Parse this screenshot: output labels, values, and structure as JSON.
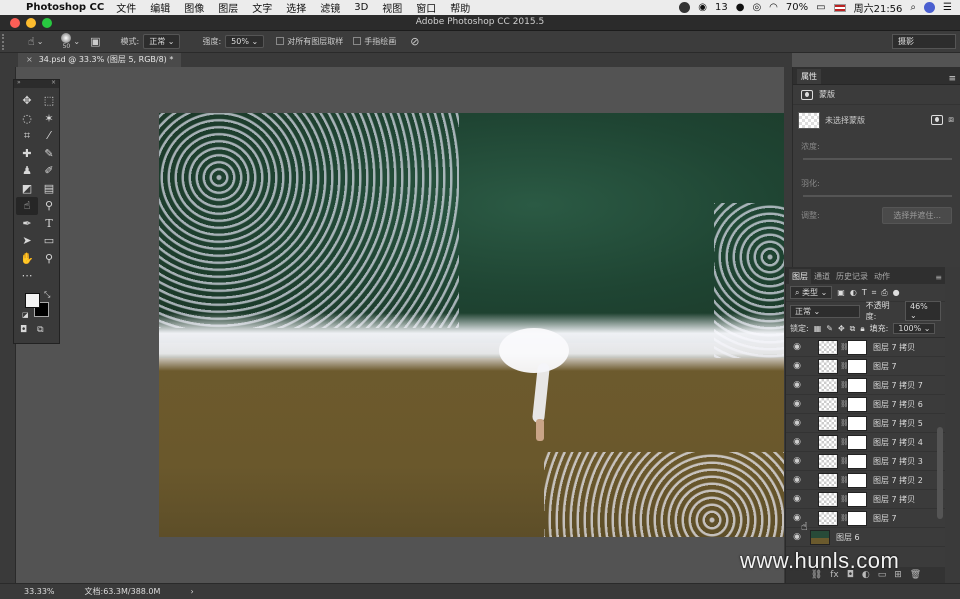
{
  "menubar": {
    "app_name": "Photoshop CC",
    "items": [
      "文件",
      "编辑",
      "图像",
      "图层",
      "文字",
      "选择",
      "滤镜",
      "3D",
      "视图",
      "窗口",
      "帮助"
    ],
    "wechat_count": "13",
    "battery": "70%",
    "clock": "周六21:56"
  },
  "titlebar": {
    "title": "Adobe Photoshop CC 2015.5"
  },
  "options": {
    "brush_size": "50",
    "mode_label": "模式:",
    "mode_value": "正常",
    "strength_label": "强度:",
    "strength_value": "50%",
    "sample_all_layers": "对所有图层取样",
    "finger_painting": "手指绘画",
    "workspace": "摄影"
  },
  "document": {
    "tab_label": "34.psd @ 33.3% (图层 5, RGB/8) *"
  },
  "properties": {
    "tab": "属性",
    "section": "蒙版",
    "no_mask": "未选择蒙版",
    "density_label": "浓度:",
    "feather_label": "羽化:",
    "adjust_label": "调整:",
    "select_mask_button": "选择并遮住..."
  },
  "layers_panel": {
    "tabs": [
      "图层",
      "通道",
      "历史记录",
      "动作"
    ],
    "filter_kind": "类型",
    "blend_mode": "正常",
    "opacity_label": "不透明度:",
    "opacity_value": "46%",
    "lock_label": "锁定:",
    "fill_label": "填充:",
    "fill_value": "100%",
    "layers": [
      {
        "name": "图层 7 拷贝"
      },
      {
        "name": "图层 7"
      },
      {
        "name": "图层 7 拷贝 7"
      },
      {
        "name": "图层 7 拷贝 6"
      },
      {
        "name": "图层 7 拷贝 5"
      },
      {
        "name": "图层 7 拷贝 4"
      },
      {
        "name": "图层 7 拷贝 3"
      },
      {
        "name": "图层 7 拷贝 2"
      },
      {
        "name": "图层 7 拷贝"
      },
      {
        "name": "图层 7"
      }
    ],
    "photo_layer": "图层 6"
  },
  "status": {
    "zoom": "33.33%",
    "doc_size": "文档:63.3M/388.0M"
  },
  "watermark": "www.hunls.com"
}
